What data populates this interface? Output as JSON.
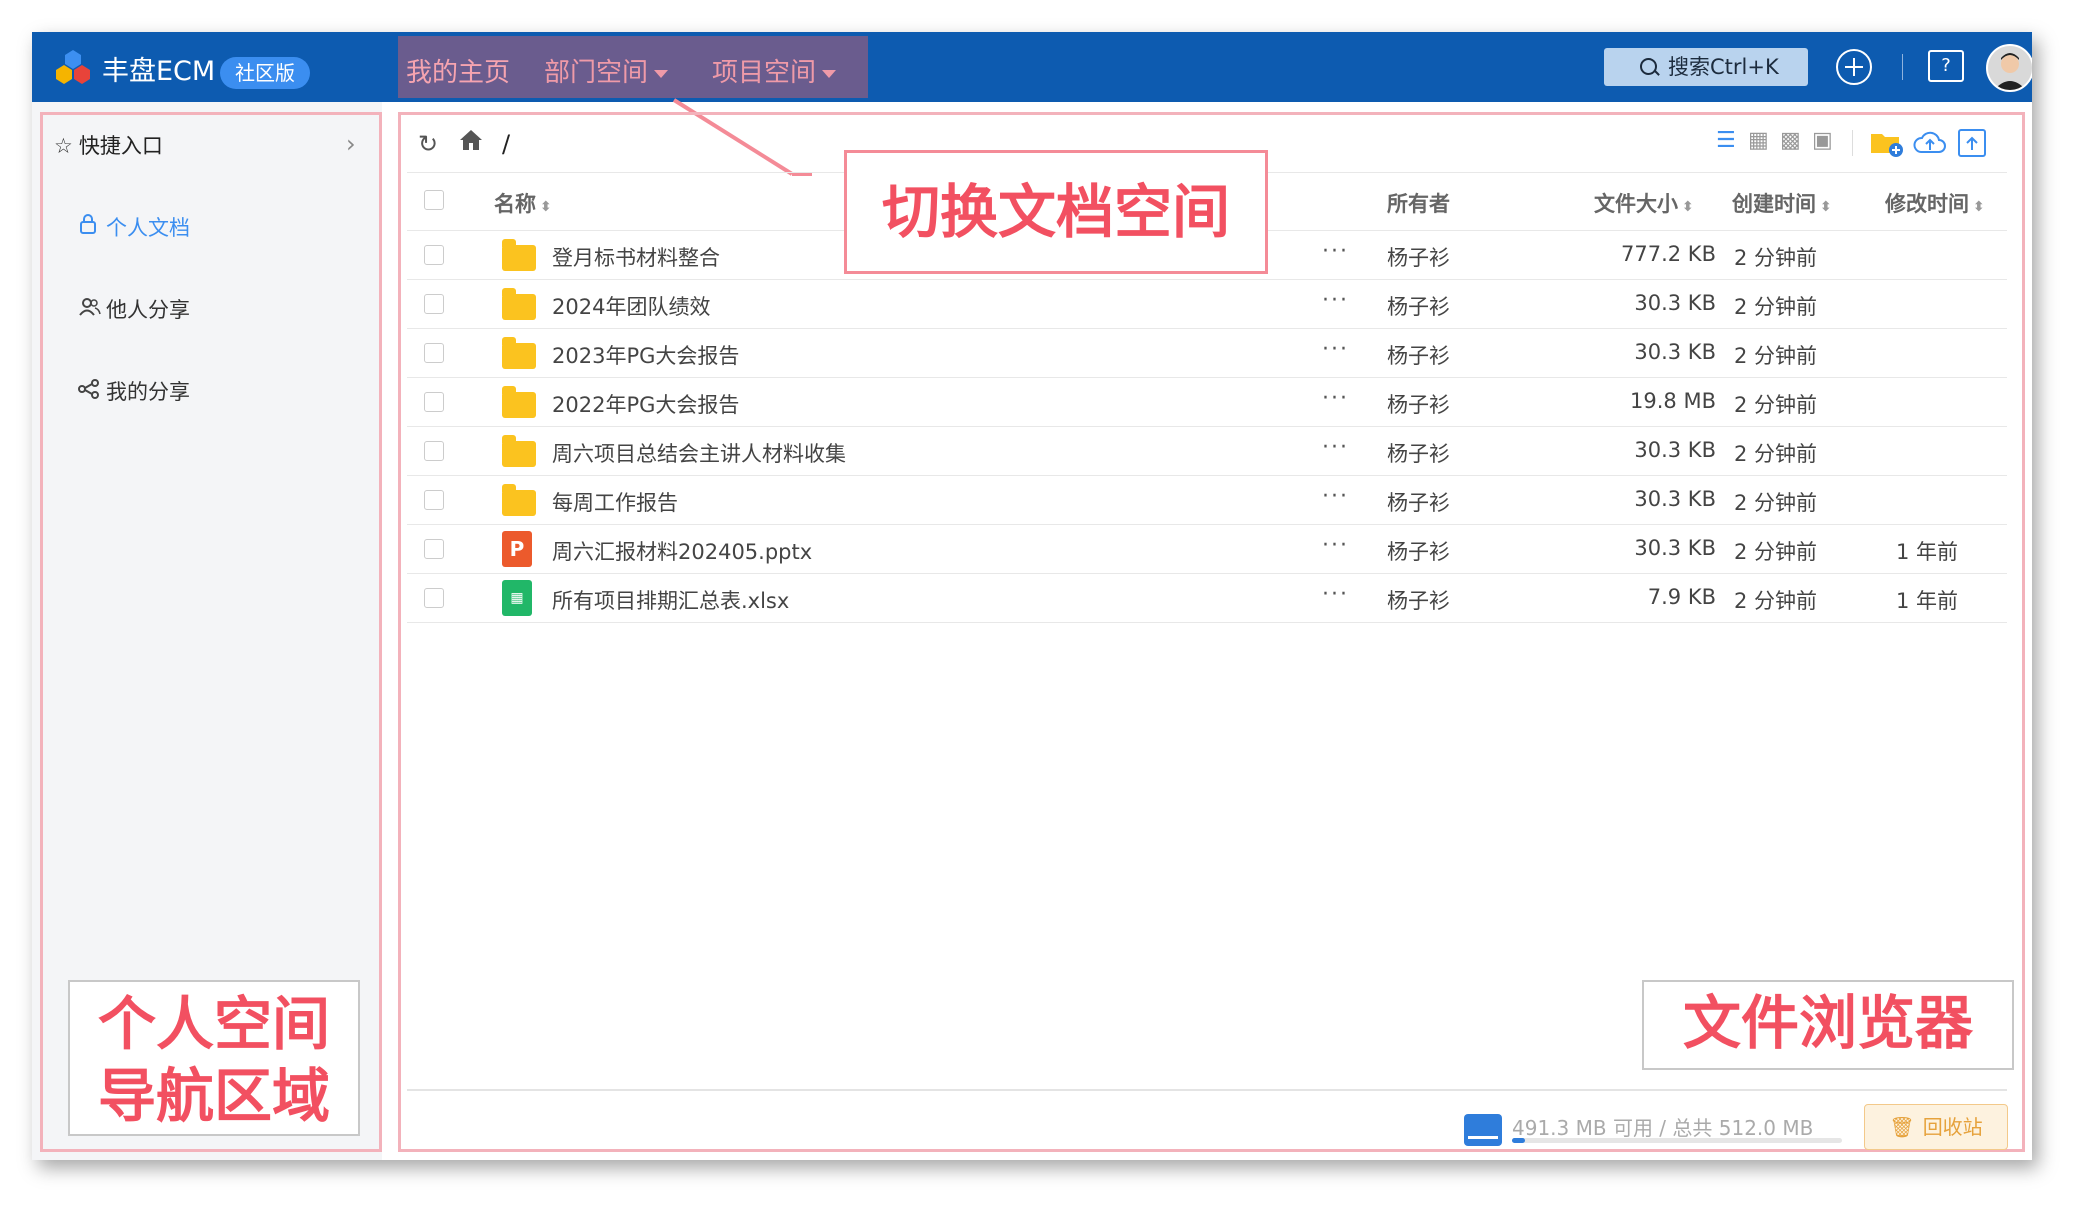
{
  "topbar": {
    "brand": "丰盘ECM",
    "edition_badge": "社区版",
    "tabs": [
      {
        "label": "我的主页",
        "active": true
      },
      {
        "label": "部门空间",
        "dropdown": true
      },
      {
        "label": "项目空间",
        "dropdown": true
      }
    ],
    "search_label": "搜索Ctrl+K",
    "help_glyph": "?"
  },
  "sidebar": {
    "quick_access": "快捷入口",
    "items": [
      {
        "label": "个人文档",
        "icon": "lock-icon",
        "active": true
      },
      {
        "label": "他人分享",
        "icon": "users-icon"
      },
      {
        "label": "我的分享",
        "icon": "share-icon"
      }
    ]
  },
  "breadcrumb": {
    "path": "/"
  },
  "table": {
    "columns": {
      "name": "名称",
      "owner": "所有者",
      "size": "文件大小",
      "created": "创建时间",
      "modified": "修改时间"
    },
    "rows": [
      {
        "name": "登月标书材料整合",
        "type": "folder",
        "owner": "杨子衫",
        "size": "777.2 KB",
        "created": "2 分钟前",
        "modified": ""
      },
      {
        "name": "2024年团队绩效",
        "type": "folder",
        "owner": "杨子衫",
        "size": "30.3 KB",
        "created": "2 分钟前",
        "modified": ""
      },
      {
        "name": "2023年PG大会报告",
        "type": "folder",
        "owner": "杨子衫",
        "size": "30.3 KB",
        "created": "2 分钟前",
        "modified": ""
      },
      {
        "name": "2022年PG大会报告",
        "type": "folder",
        "owner": "杨子衫",
        "size": "19.8 MB",
        "created": "2 分钟前",
        "modified": ""
      },
      {
        "name": "周六项目总结会主讲人材料收集",
        "type": "folder",
        "owner": "杨子衫",
        "size": "30.3 KB",
        "created": "2 分钟前",
        "modified": ""
      },
      {
        "name": "每周工作报告",
        "type": "folder",
        "owner": "杨子衫",
        "size": "30.3 KB",
        "created": "2 分钟前",
        "modified": ""
      },
      {
        "name": "周六汇报材料202405.pptx",
        "type": "pptx",
        "owner": "杨子衫",
        "size": "30.3 KB",
        "created": "2 分钟前",
        "modified": "1 年前"
      },
      {
        "name": "所有项目排期汇总表.xlsx",
        "type": "xlsx",
        "owner": "杨子衫",
        "size": "7.9 KB",
        "created": "2 分钟前",
        "modified": "1 年前"
      }
    ],
    "more_glyph": "···"
  },
  "footer": {
    "quota_text": "491.3 MB 可用 / 总共 512.0 MB",
    "quota_used_fraction": 0.04,
    "recycle_label": "回收站"
  },
  "annotations": {
    "switch_space": "切换文档空间",
    "personal_nav_line1": "个人空间",
    "personal_nav_line2": "导航区域",
    "file_browser": "文件浏览器"
  },
  "colors": {
    "topbar": "#0d5bb0",
    "accent": "#3b8ef0",
    "annotation": "#f25061",
    "folder": "#fbc31f"
  }
}
